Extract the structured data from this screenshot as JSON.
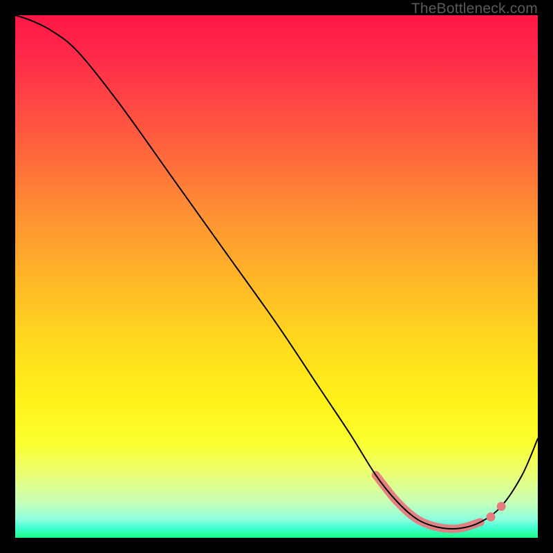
{
  "watermark": "TheBottleneck.com",
  "colors": {
    "highlight": "#e77a7e",
    "curve": "#000000"
  },
  "chart_data": {
    "type": "line",
    "title": "",
    "xlabel": "",
    "ylabel": "",
    "xlim": [
      0,
      100
    ],
    "ylim": [
      0,
      100
    ],
    "grid": false,
    "legend": false,
    "series": [
      {
        "name": "curve",
        "x": [
          0,
          3,
          7,
          12,
          20,
          30,
          40,
          50,
          58,
          64,
          69,
          73,
          77,
          81,
          85,
          89,
          93,
          97,
          100
        ],
        "y": [
          100,
          99,
          97,
          93,
          83,
          69,
          55,
          41,
          29,
          20,
          12,
          7,
          3.5,
          2,
          1.8,
          3,
          6,
          12,
          19
        ]
      },
      {
        "name": "highlight-band",
        "x": [
          69,
          73,
          77,
          81,
          85,
          89
        ],
        "y": [
          12,
          7,
          3.5,
          2,
          1.8,
          3
        ]
      },
      {
        "name": "highlight-dots",
        "x": [
          91,
          93
        ],
        "y": [
          4,
          6
        ]
      }
    ]
  }
}
